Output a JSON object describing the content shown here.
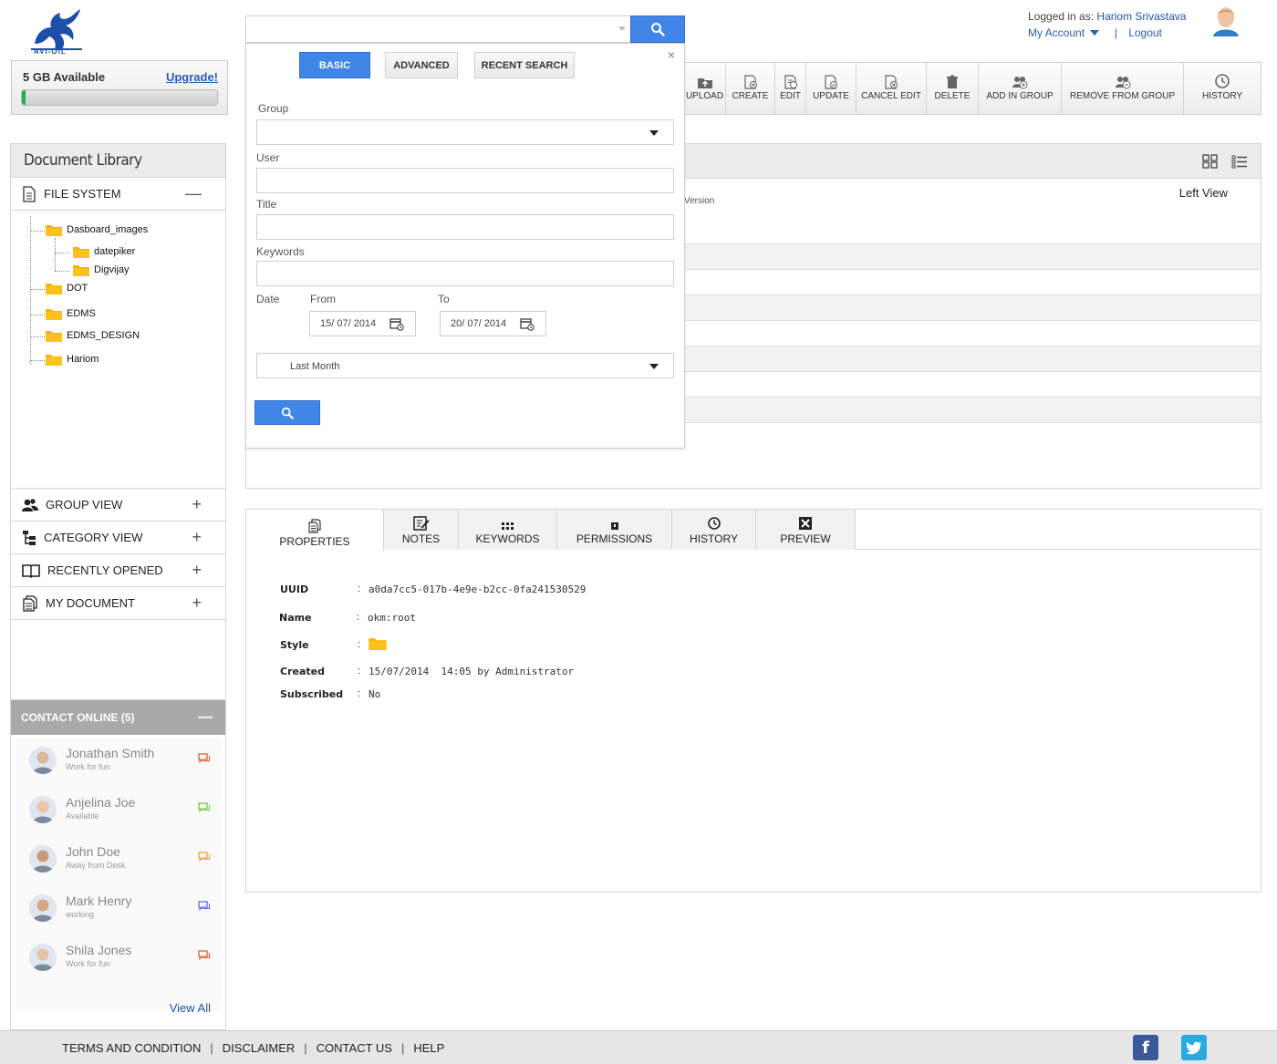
{
  "brand": {
    "name": "AVI-OIL"
  },
  "storage": {
    "available": "5 GB Available",
    "upgrade": "Upgrade!",
    "usage_fraction": 0.02
  },
  "search": {
    "placeholder": ""
  },
  "user": {
    "logged_in_label": "Logged in as:",
    "name": "Hariom Srivastava",
    "my_account": "My Account",
    "separator": "|",
    "logout": "Logout"
  },
  "toolbar": {
    "upload": "UPLOAD",
    "create": "CREATE",
    "edit": "EDIT",
    "update": "UPDATE",
    "cancel_edit": "CANCEL EDIT",
    "delete": "DELETE",
    "add_in_group": "ADD IN GROUP",
    "remove_from_group": "REMOVE FROM GROUP",
    "history": "HISTORY"
  },
  "library": {
    "title": "Document Library",
    "file_system": "FILE SYSTEM",
    "tree": {
      "dasboard_images": "Dasboard_images",
      "datepiker": "datepiker",
      "digvijay": "Digvijay",
      "dot": "DOT",
      "edms": "EDMS",
      "edms_design": "EDMS_DESIGN",
      "hariom": "Hariom"
    },
    "group_view": "GROUP VIEW",
    "category_view": "CATEGORY VIEW",
    "recently_opened": "RECENTLY OPENED",
    "my_document": "MY DOCUMENT",
    "expand_symbol": "+",
    "collapse_symbol": "—"
  },
  "contacts": {
    "title": "CONTACT ONLINE (5)",
    "collapse_symbol": "—",
    "people": [
      {
        "name": "Jonathan Smith",
        "status": "Work for fun",
        "chat_color": "#e05a3a"
      },
      {
        "name": "Anjelina Joe",
        "status": "Available",
        "chat_color": "#7cc242"
      },
      {
        "name": "John Doe",
        "status": "Away from Desk",
        "chat_color": "#f0a020"
      },
      {
        "name": "Mark Henry",
        "status": "working",
        "chat_color": "#5a6ad6"
      },
      {
        "name": "Shila Jones",
        "status": "Work for fun",
        "chat_color": "#e05a3a"
      }
    ],
    "view_all": "View All"
  },
  "list": {
    "version_col": "Version",
    "left_view": "Left View"
  },
  "advanced_search": {
    "close": "×",
    "tabs": {
      "basic": "BASIC",
      "advanced": "ADVANCED",
      "recent": "RECENT SEARCH"
    },
    "group_label": "Group",
    "user_label": "User",
    "title_label": "Title",
    "keywords_label": "Keywords",
    "date_label": "Date",
    "from_label": "From",
    "to_label": "To",
    "from_value": "15/ 07/ 2014",
    "to_value": "20/ 07/ 2014",
    "range_value": "Last Month"
  },
  "properties": {
    "tabs": {
      "properties": "PROPERTIES",
      "notes": "NOTES",
      "keywords": "KEYWORDS",
      "permissions": "PERMISSIONS",
      "history": "HISTORY",
      "preview": "PREVIEW"
    },
    "colon": ":",
    "uuid_label": "UUID",
    "uuid": "a0da7cc5-017b-4e9e-b2cc-0fa241530529",
    "name_label": "Name",
    "name": "okm:root",
    "style_label": "Style",
    "created_label": "Created",
    "created": "15/07/2014  14:05 by Administrator",
    "subscribed_label": "Subscribed",
    "subscribed": "No"
  },
  "footer": {
    "terms": "TERMS AND CONDITION",
    "disclaimer": "DISCLAIMER",
    "contact": "CONTACT US",
    "help": "HELP",
    "sep": "|",
    "facebook_glyph": "f"
  },
  "colors": {
    "accent": "#3f86e6",
    "progress": "#21b14b",
    "folder": "#f5b400",
    "facebook": "#3b5998",
    "twitter": "#2aa9e0"
  }
}
